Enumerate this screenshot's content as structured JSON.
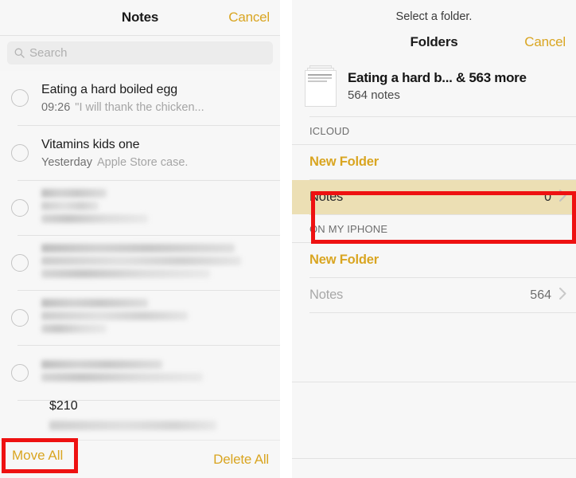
{
  "left_panel": {
    "navbar": {
      "title": "Notes",
      "cancel_label": "Cancel"
    },
    "search": {
      "placeholder": "Search",
      "icon": "search-icon"
    },
    "notes": [
      {
        "title": "Eating a hard boiled egg",
        "time": "09:26",
        "snippet": "\"I will thank the chicken...",
        "redacted": false
      },
      {
        "title": "Vitamins kids one",
        "time": "Yesterday",
        "snippet": "Apple Store case.",
        "redacted": false
      },
      {
        "title": "",
        "time": "",
        "snippet": "",
        "redacted": true
      },
      {
        "title": "",
        "time": "",
        "snippet": "",
        "redacted": true
      },
      {
        "title": "",
        "time": "",
        "snippet": "",
        "redacted": true
      },
      {
        "title": "",
        "time": "",
        "snippet": "",
        "redacted": true
      }
    ],
    "partial_note": {
      "title": "$210"
    },
    "toolbar": {
      "move_all_label": "Move All",
      "delete_all_label": "Delete All"
    }
  },
  "right_panel": {
    "prompt": "Select a folder.",
    "navbar": {
      "title": "Folders",
      "cancel_label": "Cancel"
    },
    "summary": {
      "title": "Eating a hard b... & 563 more",
      "count_label": "564 notes",
      "thumbnail_icon": "note-stack-icon"
    },
    "sections": [
      {
        "header": "ICLOUD",
        "rows": [
          {
            "name": "New Folder",
            "count": "",
            "style": "new",
            "chevron": false,
            "highlighted": false
          },
          {
            "name": "Notes",
            "count": "0",
            "style": "plain",
            "chevron": true,
            "highlighted": true
          }
        ]
      },
      {
        "header": "ON MY IPHONE",
        "rows": [
          {
            "name": "New Folder",
            "count": "",
            "style": "new",
            "chevron": false,
            "highlighted": false
          },
          {
            "name": "Notes",
            "count": "564",
            "style": "dim",
            "chevron": true,
            "highlighted": false
          }
        ]
      }
    ]
  },
  "annotations": {
    "highlight_color": "#ee1111",
    "selected_row_bg": "#ecdfb4",
    "accent_color": "#d9a521"
  }
}
